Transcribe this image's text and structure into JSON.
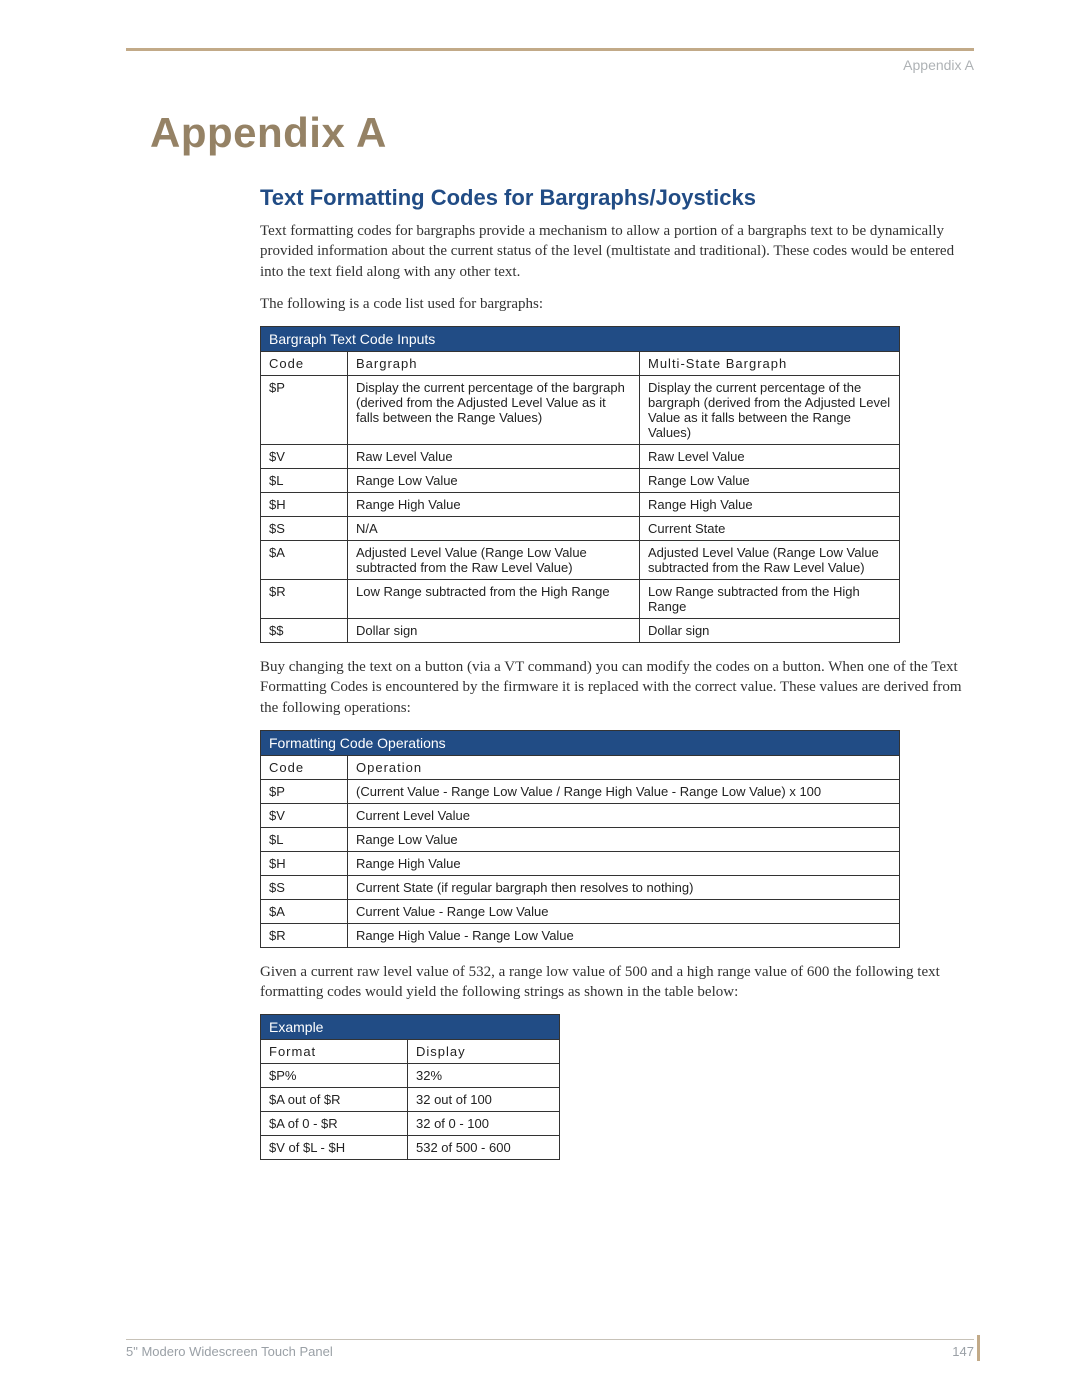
{
  "header": {
    "running": "Appendix A"
  },
  "title": "Appendix A",
  "section_heading": "Text Formatting Codes for Bargraphs/Joysticks",
  "para1": "Text formatting codes for bargraphs provide a mechanism to allow a portion of a bargraphs text to be dynamically provided information about the current status of the level (multistate and traditional). These codes would be entered into the text field along with any other text.",
  "para2": "The following is a code list used for bargraphs:",
  "table1": {
    "title": "Bargraph Text Code Inputs",
    "headers": [
      "Code",
      "Bargraph",
      "Multi-State Bargraph"
    ],
    "rows": [
      [
        "$P",
        "Display the current percentage of the bargraph (derived from the Adjusted Level Value as it falls between the Range Values)",
        "Display the current percentage of the bargraph (derived from the Adjusted Level Value as it falls between the Range Values)"
      ],
      [
        "$V",
        "Raw Level Value",
        "Raw Level Value"
      ],
      [
        "$L",
        "Range Low Value",
        "Range Low Value"
      ],
      [
        "$H",
        "Range High Value",
        "Range High Value"
      ],
      [
        "$S",
        "N/A",
        "Current State"
      ],
      [
        "$A",
        "Adjusted Level Value (Range Low Value subtracted from the Raw Level Value)",
        "Adjusted Level Value (Range Low Value subtracted from the Raw Level Value)"
      ],
      [
        "$R",
        "Low Range subtracted from the High Range",
        "Low Range subtracted from the High Range"
      ],
      [
        "$$",
        "Dollar sign",
        "Dollar sign"
      ]
    ]
  },
  "para3": "Buy changing the text on a button (via a VT command) you can modify the codes on a button. When one of the Text Formatting Codes is encountered by the firmware it is replaced with the correct value. These values are derived from the following operations:",
  "table2": {
    "title": "Formatting Code Operations",
    "headers": [
      "Code",
      "Operation"
    ],
    "rows": [
      [
        "$P",
        "(Current Value - Range Low Value / Range High Value - Range Low Value) x 100"
      ],
      [
        "$V",
        "Current Level Value"
      ],
      [
        "$L",
        "Range Low Value"
      ],
      [
        "$H",
        "Range High Value"
      ],
      [
        "$S",
        "Current State (if regular bargraph then resolves to nothing)"
      ],
      [
        "$A",
        "Current Value - Range Low Value"
      ],
      [
        "$R",
        "Range High Value - Range Low Value"
      ]
    ]
  },
  "para4": "Given a current raw level value of 532, a range low value of 500 and a high range value of 600 the following text formatting codes would yield the following strings as shown in the table below:",
  "table3": {
    "title": "Example",
    "headers": [
      "Format",
      "Display"
    ],
    "rows": [
      [
        "$P%",
        "32%"
      ],
      [
        "$A out of $R",
        "32 out of 100"
      ],
      [
        "$A of 0 - $R",
        "32 of 0 - 100"
      ],
      [
        "$V of $L - $H",
        "532 of 500 - 600"
      ]
    ]
  },
  "footer": {
    "doc": "5\" Modero Widescreen Touch Panel",
    "page": "147"
  }
}
